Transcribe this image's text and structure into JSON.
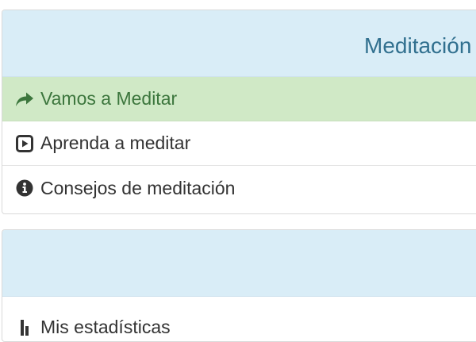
{
  "panels": [
    {
      "heading": "Meditación",
      "items": [
        {
          "label": "Vamos a Meditar",
          "icon": "share-arrow-icon",
          "active": true
        },
        {
          "label": "Aprenda a meditar",
          "icon": "play-square-icon",
          "active": false
        },
        {
          "label": "Consejos de meditación",
          "icon": "info-circle-icon",
          "active": false
        }
      ]
    },
    {
      "heading": "",
      "items": [
        {
          "label": "Mis estadísticas",
          "icon": "bar-chart-icon",
          "active": false
        }
      ]
    }
  ],
  "colors": {
    "heading_bg": "#d9edf7",
    "heading_text": "#31708f",
    "active_bg": "#d0e9c6",
    "active_text": "#3c763d",
    "text": "#333333"
  }
}
